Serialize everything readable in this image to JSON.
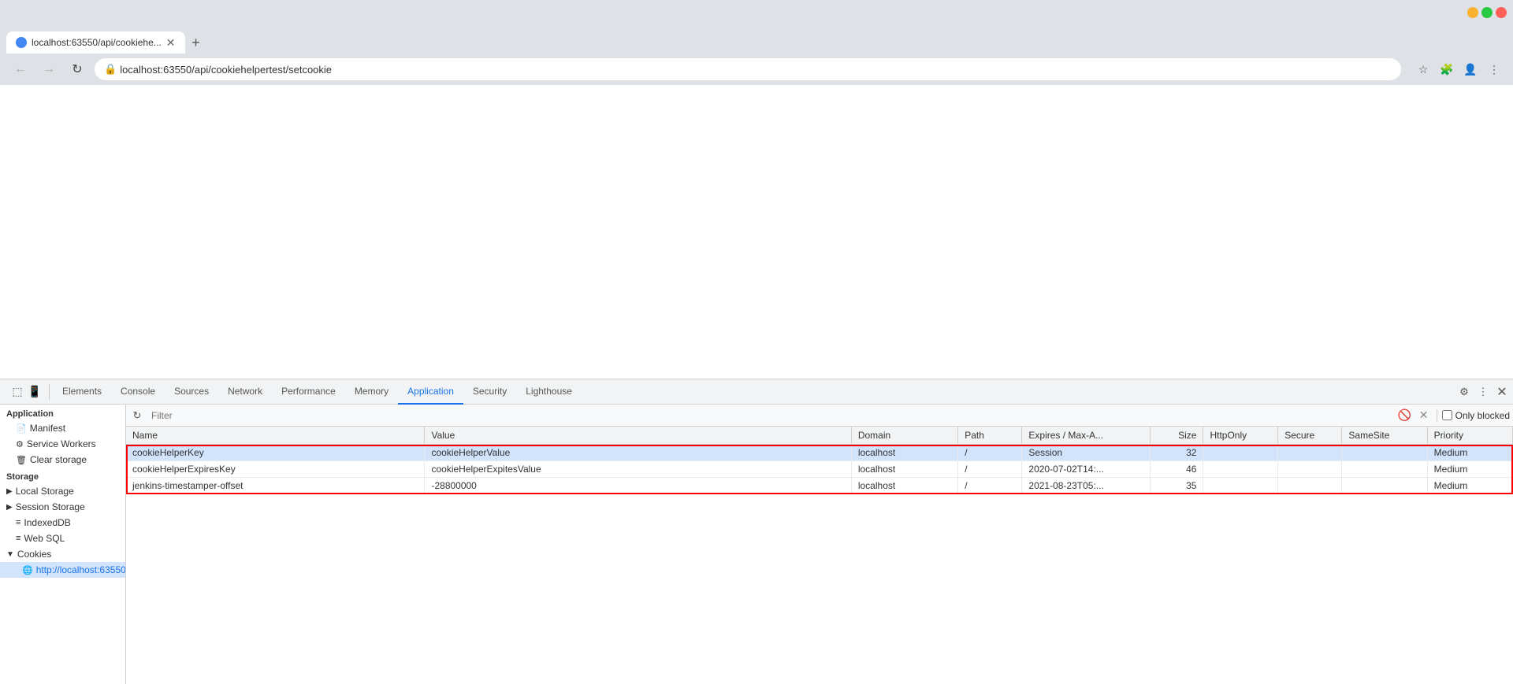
{
  "browser": {
    "tab_title": "localhost:63550/api/cookiehe...",
    "url": "localhost:63550/api/cookiehelpertest/setcookie",
    "new_tab_label": "+"
  },
  "devtools": {
    "tabs": [
      {
        "label": "Elements",
        "active": false
      },
      {
        "label": "Console",
        "active": false
      },
      {
        "label": "Sources",
        "active": false
      },
      {
        "label": "Network",
        "active": false
      },
      {
        "label": "Performance",
        "active": false
      },
      {
        "label": "Memory",
        "active": false
      },
      {
        "label": "Application",
        "active": true
      },
      {
        "label": "Security",
        "active": false
      },
      {
        "label": "Lighthouse",
        "active": false
      }
    ]
  },
  "sidebar": {
    "section_label": "Application",
    "items": [
      {
        "label": "Manifest",
        "icon": "📄",
        "indent": 1
      },
      {
        "label": "Service Workers",
        "icon": "⚙️",
        "indent": 1
      },
      {
        "label": "Clear storage",
        "icon": "🗑️",
        "indent": 1
      }
    ],
    "storage_section": "Storage",
    "storage_items": [
      {
        "label": "Local Storage",
        "icon": "≡≡",
        "indent": 1,
        "expanded": false
      },
      {
        "label": "Session Storage",
        "icon": "≡≡",
        "indent": 1,
        "expanded": false
      },
      {
        "label": "IndexedDB",
        "icon": "≡",
        "indent": 1,
        "expanded": false
      },
      {
        "label": "Web SQL",
        "icon": "≡",
        "indent": 1,
        "expanded": false
      },
      {
        "label": "Cookies",
        "icon": "🍪",
        "indent": 1,
        "expanded": true
      }
    ],
    "cookies_subitem": "http://localhost:63550"
  },
  "cookie_toolbar": {
    "filter_placeholder": "Filter",
    "only_blocked_label": "Only blocked"
  },
  "cookie_table": {
    "columns": [
      "Name",
      "Value",
      "Domain",
      "Path",
      "Expires / Max-A...",
      "Size",
      "HttpOnly",
      "Secure",
      "SameSite",
      "Priority"
    ],
    "rows": [
      {
        "name": "cookieHelperKey",
        "value": "cookieHelperValue",
        "domain": "localhost",
        "path": "/",
        "expires": "Session",
        "size": "32",
        "httponly": "",
        "secure": "",
        "samesite": "",
        "priority": "Medium",
        "selected": true,
        "highlighted": true
      },
      {
        "name": "cookieHelperExpiresKey",
        "value": "cookieHelperExpitesValue",
        "domain": "localhost",
        "path": "/",
        "expires": "2020-07-02T14:...",
        "size": "46",
        "httponly": "",
        "secure": "",
        "samesite": "",
        "priority": "Medium",
        "selected": false,
        "highlighted": true
      },
      {
        "name": "jenkins-timestamper-offset",
        "value": "-28800000",
        "domain": "localhost",
        "path": "/",
        "expires": "2021-08-23T05:...",
        "size": "35",
        "httponly": "",
        "secure": "",
        "samesite": "",
        "priority": "Medium",
        "selected": false,
        "highlighted": true
      }
    ]
  }
}
